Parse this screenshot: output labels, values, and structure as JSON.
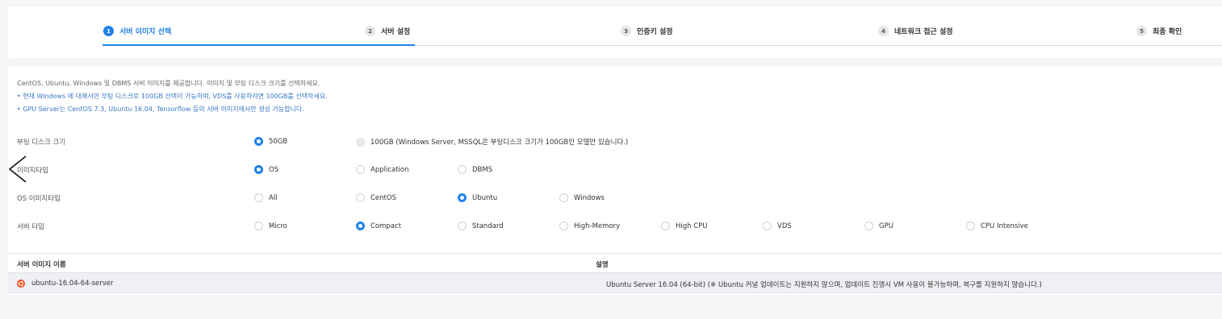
{
  "steps": [
    {
      "num": "1",
      "label": "서버 이미지 선택"
    },
    {
      "num": "2",
      "label": "서버 설정"
    },
    {
      "num": "3",
      "label": "인증키 설정"
    },
    {
      "num": "4",
      "label": "네트워크 접근 설정"
    },
    {
      "num": "5",
      "label": "최종 확인"
    }
  ],
  "notes": {
    "main": "CentOS, Ubuntu, Windows 및 DBMS 서버 이미지를 제공합니다. 이미지 및 부팅 디스크 크기를 선택하세요.",
    "bullet1": "• 현재 Windows 에 대해서만 부팅 디스크로 100GB 선택이 가능하며, VDS를 사용하려면 100GB를 선택하세요.",
    "bullet2": "• GPU Server는 CentOS 7.3, Ubuntu 16.04, Tensorflow 등의 서버 이미지에서만 생성 가능합니다."
  },
  "boot_disk": {
    "label": "부팅 디스크 크기",
    "options": [
      "50GB",
      "100GB (Windows Server, MSSQL은 부팅디스크 크기가 100GB인 모델만 있습니다.)"
    ],
    "selected": "50GB"
  },
  "image_type": {
    "label": "이미지타입",
    "options": [
      "OS",
      "Application",
      "DBMS"
    ],
    "selected": "OS"
  },
  "os_image_type": {
    "label": "OS 이미지타입",
    "options": [
      "All",
      "CentOS",
      "Ubuntu",
      "Windows"
    ],
    "selected": "Ubuntu"
  },
  "server_type": {
    "label": "서버 타입",
    "options": [
      "Micro",
      "Compact",
      "Standard",
      "High-Memory",
      "High CPU",
      "VDS",
      "GPU",
      "CPU Intensive"
    ],
    "selected": "Compact"
  },
  "table": {
    "headers": [
      "서버 이미지 이름",
      "설명"
    ],
    "rows": [
      {
        "name": "ubuntu-16.04-64-server",
        "desc": "Ubuntu Server 16.04 (64-bit) (※ Ubuntu 커널 업데이트는 지원하지 않으며, 업데이트 진행시 VM 사용이 불가능하며, 복구를 지원하지 않습니다.)",
        "icon": "ubuntu-icon"
      }
    ]
  },
  "colors": {
    "accent": "#1e80e6",
    "note_blue": "#3a78c2",
    "ubuntu": "#e95420"
  }
}
